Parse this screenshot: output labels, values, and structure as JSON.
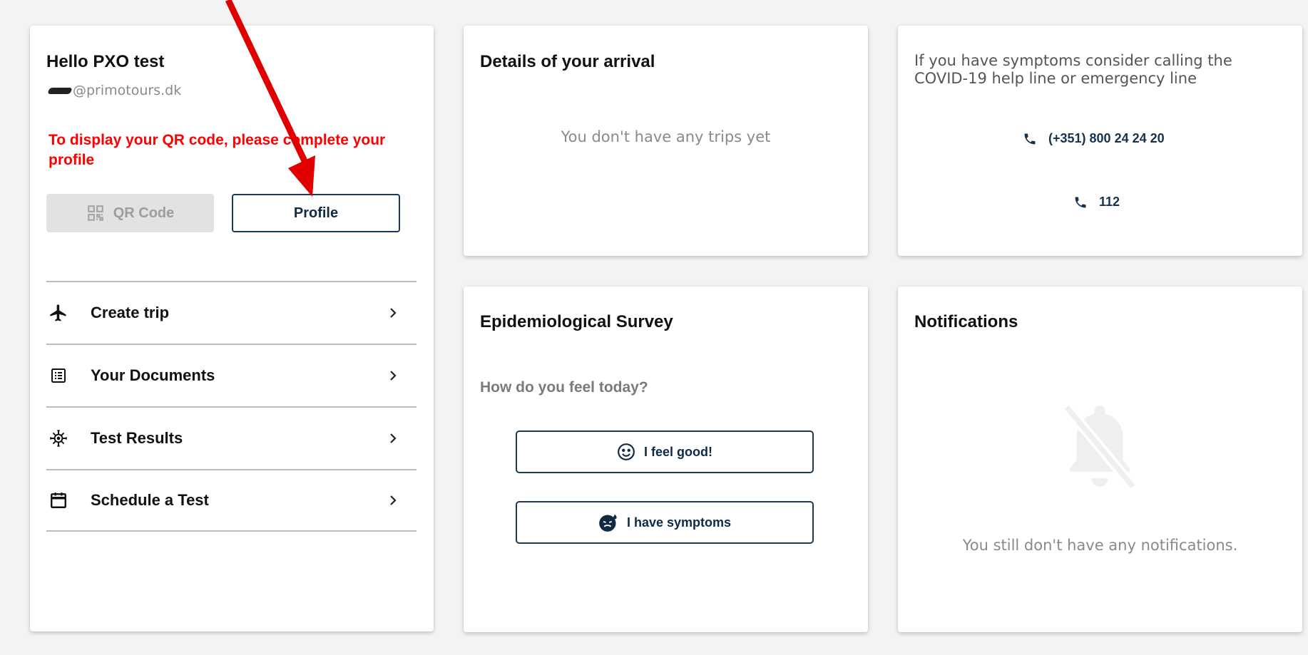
{
  "user_card": {
    "greeting": "Hello PXO test",
    "email": "@primotours.dk",
    "warning": "To display your QR code, please complete your profile",
    "qr_button": "QR Code",
    "profile_button": "Profile",
    "menu": [
      {
        "label": "Create trip",
        "icon": "airplane-icon"
      },
      {
        "label": "Your Documents",
        "icon": "document-list-icon"
      },
      {
        "label": "Test Results",
        "icon": "virus-icon"
      },
      {
        "label": "Schedule a Test",
        "icon": "calendar-icon"
      }
    ]
  },
  "arrival_card": {
    "title": "Details of your arrival",
    "empty_text": "You don't have any trips yet"
  },
  "help_card": {
    "text": "If you have symptoms consider calling the COVID-19 help line or emergency line",
    "phones": [
      "(+351) 800 24 24 20",
      "112"
    ]
  },
  "survey_card": {
    "title": "Epidemiological Survey",
    "question": "How do you feel today?",
    "good_button": "I feel good!",
    "symptoms_button": "I have symptoms"
  },
  "notifications_card": {
    "title": "Notifications",
    "empty_text": "You still don't have any notifications."
  },
  "colors": {
    "accent": "#1b3a57",
    "warning": "#ff0000",
    "annotation_arrow": "#e00000"
  }
}
